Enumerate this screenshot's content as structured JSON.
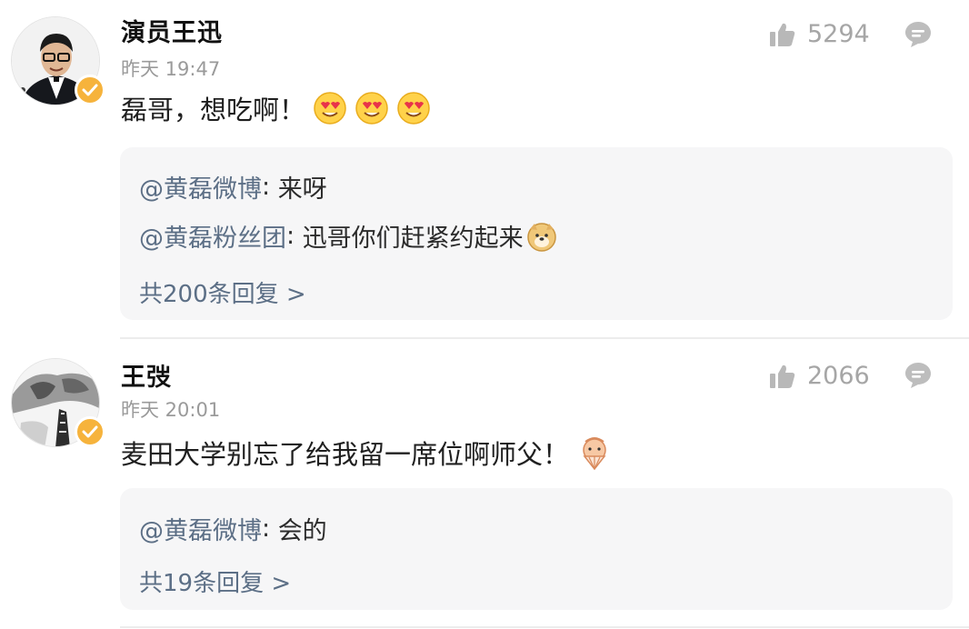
{
  "comments": [
    {
      "author": "演员王迅",
      "time": "昨天 19:47",
      "likes": "5294",
      "text": "磊哥，想吃啊！",
      "emojis": [
        "heart-eyes-emoji",
        "heart-eyes-emoji",
        "heart-eyes-emoji"
      ],
      "replies": [
        {
          "author": "@黄磊微博",
          "sep": ": ",
          "text": "来呀"
        },
        {
          "author": "@黄磊粉丝团",
          "sep": ": ",
          "text": "迅哥你们赶紧约起来",
          "emoji": "doge-emoji"
        }
      ],
      "more": "共200条回复 >"
    },
    {
      "author": "王弢",
      "time": "昨天 20:01",
      "likes": "2066",
      "text": "麦田大学别忘了给我留一席位啊师父！",
      "emojis": [
        "shy-fan-emoji"
      ],
      "replies": [
        {
          "author": "@黄磊微博",
          "sep": ": ",
          "text": "会的"
        }
      ],
      "more": "共19条回复 >"
    }
  ],
  "colors": {
    "badge": "#f6b33c",
    "link": "#5c6f86",
    "muted": "#a6a6a6",
    "reply_bg": "#f6f6f7"
  },
  "icons": {
    "like": "thumbs-up-icon",
    "reply": "comment-bubble-icon",
    "verified": "verified-check-icon"
  }
}
